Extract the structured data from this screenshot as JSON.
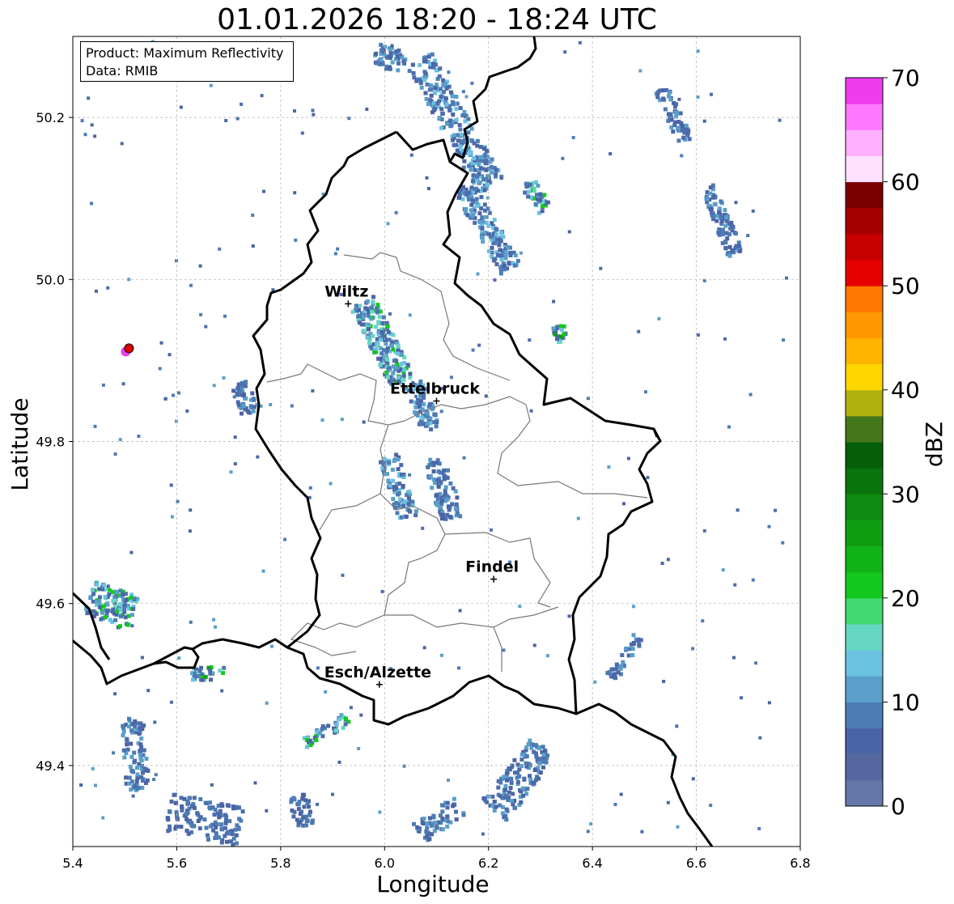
{
  "title": "01.01.2026 18:20 - 18:24 UTC",
  "info": {
    "product": "Product: Maximum Reflectivity",
    "data": "Data: RMIB"
  },
  "axes": {
    "xlabel": "Longitude",
    "ylabel": "Latitude",
    "xticks": [
      "5.4",
      "5.6",
      "5.8",
      "6.0",
      "6.2",
      "6.4",
      "6.6",
      "6.8"
    ],
    "yticks": [
      "49.4",
      "49.6",
      "49.8",
      "50.0",
      "50.2"
    ],
    "xlim": [
      5.4,
      6.8
    ],
    "ylim": [
      49.3,
      50.3
    ]
  },
  "colorbar": {
    "label": "dBZ",
    "ticks": [
      "0",
      "10",
      "20",
      "30",
      "40",
      "50",
      "60",
      "70"
    ],
    "range": [
      0,
      70
    ],
    "colors": [
      "#6577a8",
      "#56679f",
      "#4a64a5",
      "#4d7cb5",
      "#5a9fca",
      "#6ac2e0",
      "#66d6c4",
      "#40d96f",
      "#14c81e",
      "#10b318",
      "#0f9e12",
      "#0d8b10",
      "#0a740c",
      "#065e08",
      "#45771a",
      "#afb00e",
      "#ffd600",
      "#ffb400",
      "#ff9800",
      "#ff7800",
      "#e60000",
      "#c80000",
      "#a60000",
      "#7a0000",
      "#ffe0ff",
      "#ffb0ff",
      "#ff78ff",
      "#ee3cee"
    ]
  },
  "cities": [
    {
      "name": "Wiltz",
      "lon": 5.93,
      "lat": 49.97
    },
    {
      "name": "Ettelbruck",
      "lon": 6.1,
      "lat": 49.85
    },
    {
      "name": "Findel",
      "lon": 6.21,
      "lat": 49.63
    },
    {
      "name": "Esch/Alzette",
      "lon": 5.99,
      "lat": 49.5
    }
  ],
  "radar_marker": {
    "lon": 5.505,
    "lat": 49.915
  }
}
